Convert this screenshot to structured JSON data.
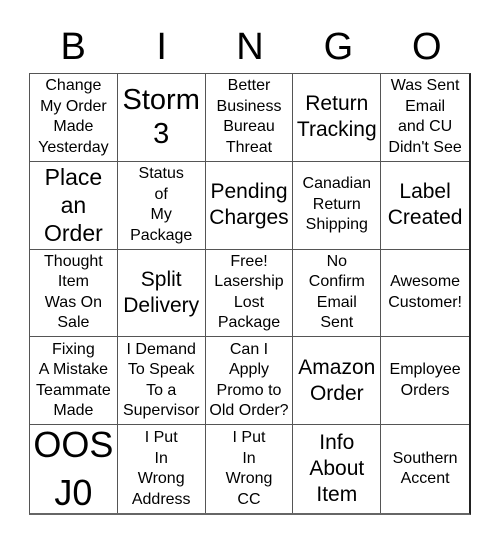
{
  "header": {
    "letters": [
      "B",
      "I",
      "N",
      "G",
      "O"
    ]
  },
  "cells": [
    {
      "text": "Change\nMy Order\nMade\nYesterday",
      "size": "s16"
    },
    {
      "text": "Storm\n3",
      "size": "s30"
    },
    {
      "text": "Better\nBusiness\nBureau\nThreat",
      "size": "s16"
    },
    {
      "text": "Return\nTracking",
      "size": "s20"
    },
    {
      "text": "Was Sent\nEmail\nand CU\nDidn't See",
      "size": "s16"
    },
    {
      "text": "Place\nan\nOrder",
      "size": "s24"
    },
    {
      "text": "Status\nof\nMy\nPackage",
      "size": "s16"
    },
    {
      "text": "Pending\nCharges",
      "size": "s20"
    },
    {
      "text": "Canadian\nReturn\nShipping",
      "size": "s16"
    },
    {
      "text": "Label\nCreated",
      "size": "s20"
    },
    {
      "text": "Thought\nItem\nWas On\nSale",
      "size": "s16"
    },
    {
      "text": "Split\nDelivery",
      "size": "s20"
    },
    {
      "text": "Free!\nLasership\nLost\nPackage",
      "size": "s16"
    },
    {
      "text": "No\nConfirm\nEmail\nSent",
      "size": "s16"
    },
    {
      "text": "Awesome\nCustomer!",
      "size": "s16"
    },
    {
      "text": "Fixing\nA Mistake\nTeammate\nMade",
      "size": "s16"
    },
    {
      "text": "I Demand\nTo Speak\nTo a\nSupervisor",
      "size": "s16"
    },
    {
      "text": "Can I\nApply\nPromo to\nOld Order?",
      "size": "s16"
    },
    {
      "text": "Amazon\nOrder",
      "size": "s20"
    },
    {
      "text": "Employee\nOrders",
      "size": "s16"
    },
    {
      "text": "OOS\nJ0",
      "size": "s36"
    },
    {
      "text": "I Put\nIn\nWrong\nAddress",
      "size": "s16"
    },
    {
      "text": "I Put\nIn\nWrong\nCC",
      "size": "s16"
    },
    {
      "text": "Info\nAbout\nItem",
      "size": "s20"
    },
    {
      "text": "Southern\nAccent",
      "size": "s16"
    }
  ]
}
